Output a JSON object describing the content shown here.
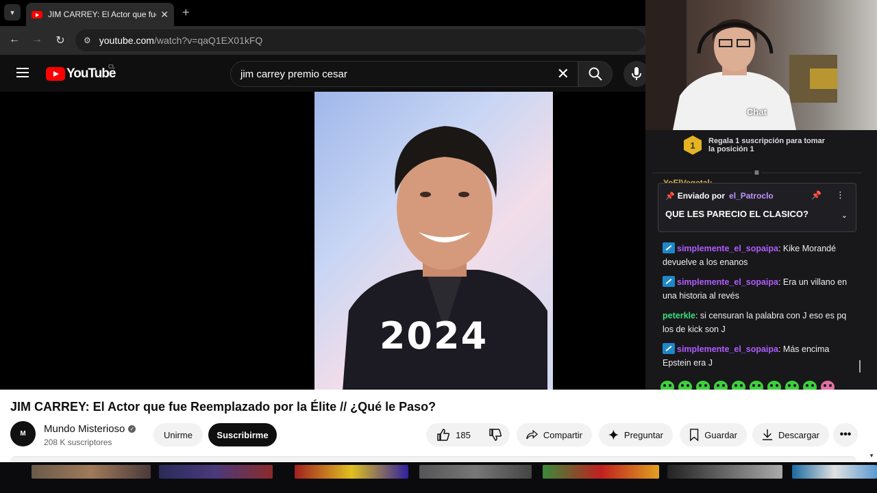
{
  "browser": {
    "tab_title": "JIM CARREY: El Actor que fue Reemplazado",
    "url_host": "youtube.com",
    "url_path": "/watch?v=qaQ1EX01kFQ"
  },
  "youtube": {
    "logo_text": "YouTube",
    "country_code": "CL",
    "search_query": "jim carrey premio cesar"
  },
  "video": {
    "overlay_year": "2024",
    "title": "JIM CARREY: El Actor que fue Reemplazado por la Élite // ¿Qué le Paso?",
    "channel_name": "Mundo Misterioso",
    "channel_avatar_text": "M",
    "subscribers": "208 K suscriptores",
    "join_label": "Unirme",
    "subscribe_label": "Suscribirme",
    "likes": "185",
    "share_label": "Compartir",
    "ask_label": "Preguntar",
    "save_label": "Guardar",
    "download_label": "Descargar"
  },
  "stream": {
    "webcam_chat_label": "Chat",
    "gift_position": "1",
    "gift_text": "Regala 1 suscripción para tomar la posición 1",
    "ghost_line": "YoElVegetal:",
    "pinned": {
      "sent_by_label": "Enviado por",
      "user": "el_Patroclo",
      "message": "QUE LES PARECIO EL CLASICO?"
    },
    "messages": [
      {
        "user": "simplemente_el_sopaipa",
        "text": ": Kike Morandé devuelve a los enanos"
      },
      {
        "user": "simplemente_el_sopaipa",
        "text": ": Era un villano en una historia al revés"
      },
      {
        "user": "peterkle",
        "text": ": si censuran la palabra con J eso es pq los de kick son J"
      },
      {
        "user": "simplemente_el_sopaipa",
        "text": ": Más encima Epstein era J"
      }
    ]
  },
  "colors": {
    "youtube_red": "#ff0000",
    "chat_bg": "#18181b",
    "chat_purple_user": "#b05cff",
    "chat_green_user": "#39e07a",
    "gift_gold": "#e6b422"
  }
}
